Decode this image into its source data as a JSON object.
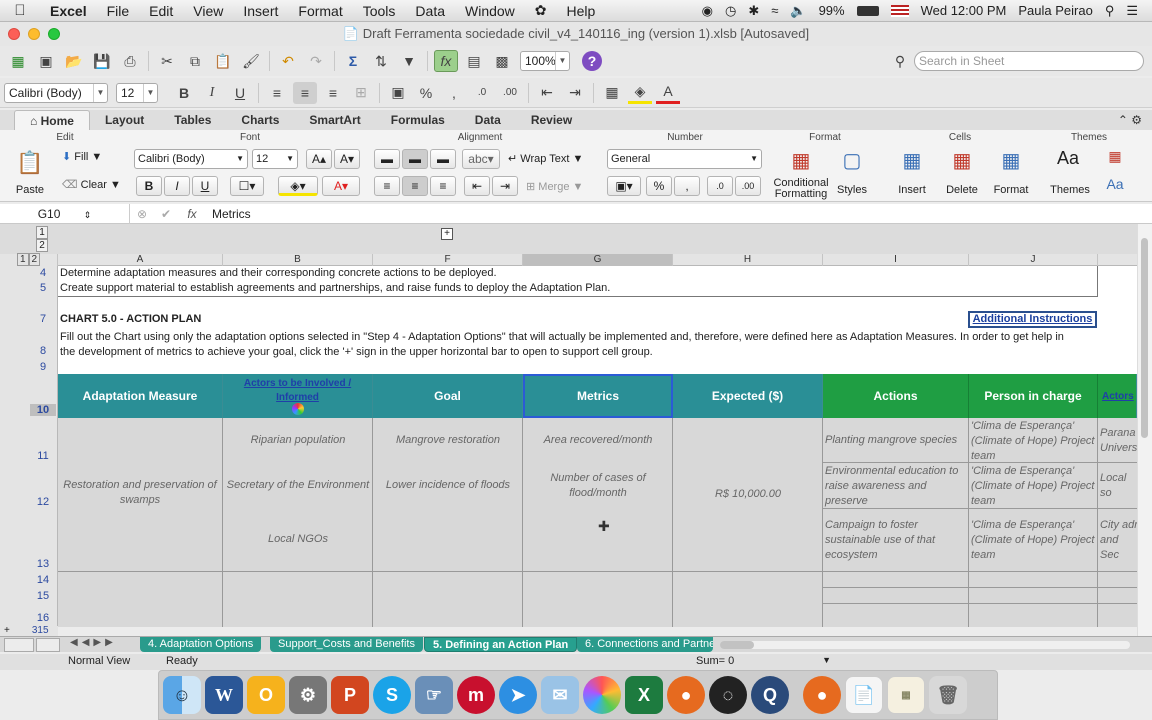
{
  "menubar": {
    "app": "Excel",
    "items": [
      "File",
      "Edit",
      "View",
      "Insert",
      "Format",
      "Tools",
      "Data",
      "Window",
      "Help"
    ],
    "battery": "99%",
    "clock": "Wed 12:00 PM",
    "user": "Paula Peirao"
  },
  "window": {
    "title": "Draft Ferramenta sociedade civil_v4_140116_ing (version 1).xlsb [Autosaved]"
  },
  "toolbar": {
    "zoom": "100%",
    "search_placeholder": "Search in Sheet",
    "font": "Calibri (Body)",
    "size": "12"
  },
  "ribbon": {
    "tabs": [
      "Home",
      "Layout",
      "Tables",
      "Charts",
      "SmartArt",
      "Formulas",
      "Data",
      "Review"
    ],
    "groups": {
      "edit": "Edit",
      "font": "Font",
      "alignment": "Alignment",
      "number": "Number",
      "format": "Format",
      "cells": "Cells",
      "themes": "Themes"
    },
    "fill": "Fill",
    "clear": "Clear",
    "paste": "Paste",
    "font": "Calibri (Body)",
    "size": "12",
    "bold": "B",
    "italic": "I",
    "underline": "U",
    "wrap_text": "Wrap Text",
    "merge": "Merge",
    "abc": "abc",
    "number_format": "General",
    "conditional": "Conditional Formatting",
    "styles": "Styles",
    "insert": "Insert",
    "delete": "Delete",
    "format": "Format",
    "themes": "Themes"
  },
  "formula_bar": {
    "cell_ref": "G10",
    "fx": "fx",
    "content": "Metrics"
  },
  "columns": [
    "A",
    "B",
    "F",
    "G",
    "H",
    "I",
    "J"
  ],
  "rows": [
    "4",
    "5",
    "7",
    "8",
    "9",
    "10",
    "11",
    "12",
    "13",
    "14",
    "15",
    "16",
    "315"
  ],
  "outline_levels": [
    "1",
    "2",
    "1",
    "2"
  ],
  "sheet": {
    "row4": "Determine adaptation measures and their corresponding concrete actions to be deployed.",
    "row5": "Create support material to establish agreements and partnerships, and raise funds to deploy the Adaptation Plan.",
    "chart_title": "CHART 5.0 - ACTION PLAN",
    "additional_instructions": "Additional Instructions",
    "instructions_line1": "Fill out the Chart using only the adaptation options selected in \"Step 4 - Adaptation Options\" that will actually be implemented and, therefore, were defined here as Adaptation Measures. In order to get help in",
    "instructions_line2": "the development of metrics to achieve your goal, click the '+' sign in the upper horizontal bar to open to support cell group.",
    "headers": {
      "adaptation_measure": "Adaptation Measure",
      "actors": "Actors to be Involved / Informed",
      "goal": "Goal",
      "metrics": "Metrics",
      "expected": "Expected ($)",
      "actions": "Actions",
      "person": "Person in charge",
      "actors2": "Actors"
    },
    "measure": "Restoration and preservation of swamps",
    "actors_list": [
      "Riparian population",
      "Secretary of the Environment",
      "Local NGOs"
    ],
    "goals": [
      "Mangrove restoration",
      "Lower incidence of floods"
    ],
    "metrics": [
      "Area recovered/month",
      "Number of cases of flood/month"
    ],
    "expected": "R$ 10,000.00",
    "actions": [
      "Planting mangrove species",
      "Environmental education to raise awareness and preserve",
      "Campaign to foster sustainable use of that ecosystem"
    ],
    "person": "'Clima de Esperança' (Climate of Hope) Project team",
    "actors2": [
      "Parana Univers",
      "Local so univers",
      "City adr and Sec Environ"
    ]
  },
  "sheet_tabs": [
    "4. Adaptation Options",
    "Support_Costs and Benefits",
    "5. Defining an Action Plan",
    "6. Connections and Partne"
  ],
  "status": {
    "view": "Normal View",
    "ready": "Ready",
    "sum": "Sum= 0"
  },
  "dock": [
    "Finder",
    "Word",
    "Outlook",
    "System Preferences",
    "PowerPoint",
    "Skype",
    "Preview",
    "Mendeley",
    "Safari",
    "Mail",
    "Photos",
    "Excel",
    "Firefox",
    "OBS",
    "QuickTime",
    "Firefox",
    "Document",
    "Certificate",
    "Trash"
  ],
  "colors": {
    "teal": "#2a8f96",
    "green": "#1f9e43",
    "sheet_tab": "#2a9b8c"
  }
}
